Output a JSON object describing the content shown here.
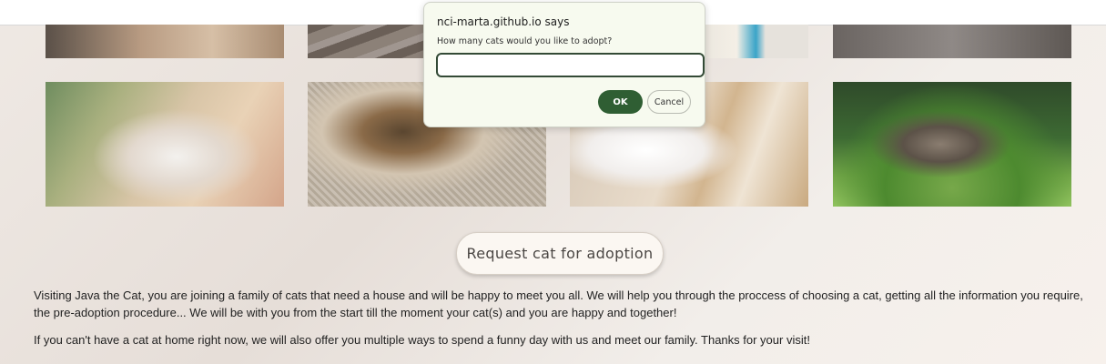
{
  "dialog": {
    "title": "nci-marta.github.io says",
    "message": "How many cats would you like to adopt?",
    "input_value": "",
    "ok_label": "OK",
    "cancel_label": "Cancel"
  },
  "gallery": {
    "photos": [
      {
        "name": "cat-photo-top-1"
      },
      {
        "name": "cat-photo-top-2"
      },
      {
        "name": "cat-photo-top-3"
      },
      {
        "name": "cat-photo-top-4"
      },
      {
        "name": "kitten-on-bed-photo"
      },
      {
        "name": "tabby-cat-on-carpet-photo"
      },
      {
        "name": "white-kitten-photo"
      },
      {
        "name": "kitten-in-grass-photo"
      }
    ]
  },
  "main": {
    "request_button_label": "Request cat for adoption",
    "paragraph1": "Visiting Java the Cat, you are joining a family of cats that need a house and will be happy to meet you all. We will help you through the proccess of choosing a cat, getting all the information you require, the pre-adoption procedure... We will be with you from the start till the moment your cat(s) and you are happy and together!",
    "paragraph2": "If you can't have a cat at home right now, we will also offer you multiple ways to spend a funny day with us and meet our family. Thanks for your visit!"
  },
  "colors": {
    "ok_button": "#2f5e33",
    "dialog_background": "#f7faef"
  }
}
